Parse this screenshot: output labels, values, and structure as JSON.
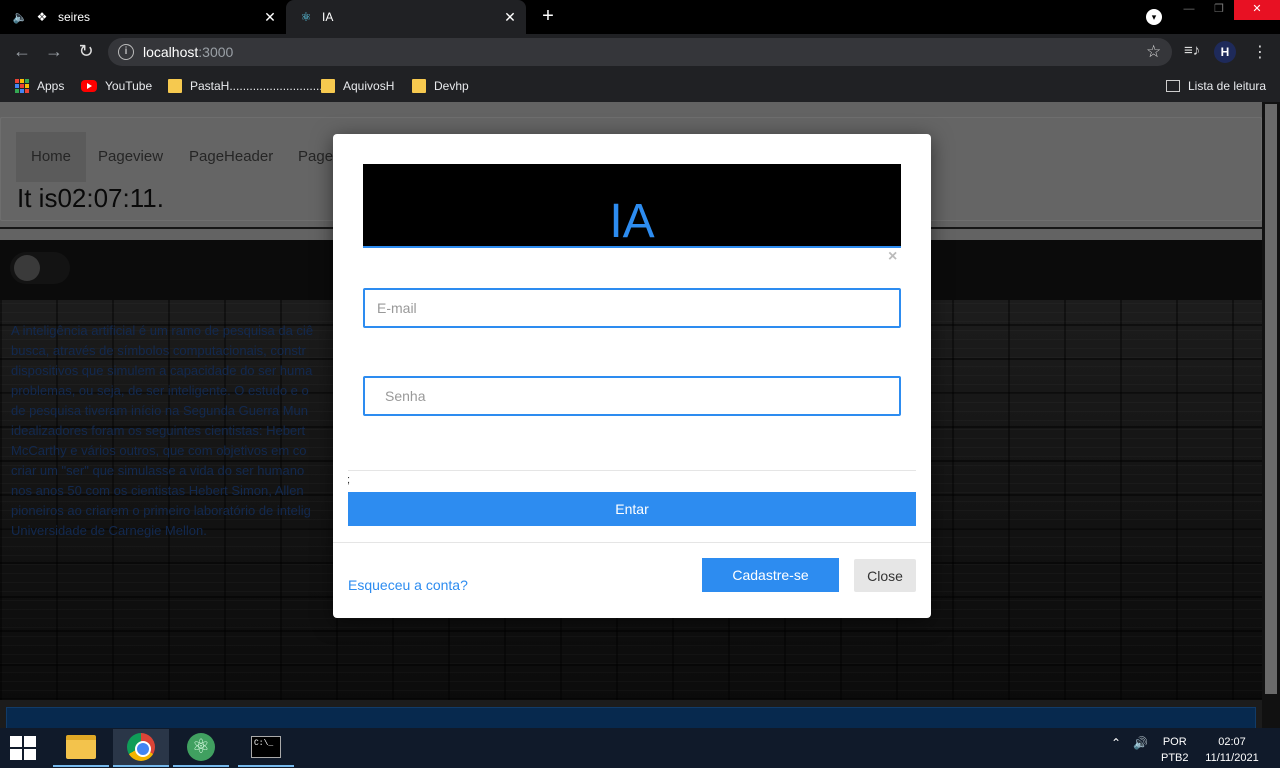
{
  "browser": {
    "tabs": [
      {
        "title": "seires",
        "icon": "audio-icon"
      },
      {
        "title": "IA",
        "icon": "react-icon"
      }
    ],
    "url_host": "localhost",
    "url_port": ":3000",
    "avatar_letter": "H",
    "bookmarks": [
      {
        "label": "Apps",
        "icon": "apps-grid-icon"
      },
      {
        "label": "YouTube",
        "icon": "youtube-icon"
      },
      {
        "label": "PastaH..............................",
        "icon": "folder-icon"
      },
      {
        "label": "AquivosH",
        "icon": "folder-icon"
      },
      {
        "label": "Devhp",
        "icon": "folder-icon"
      }
    ],
    "reading_list": "Lista de leitura"
  },
  "page": {
    "nav": [
      "Home",
      "Pageview",
      "PageHeader",
      "Page"
    ],
    "clock_text": "It is02:07:11.",
    "hero_text": "A inteligência artificial é um ramo de pesquisa da ciê\nbusca, através de símbolos computacionais, constr\ndispositivos que simulem a capacidade do ser huma\nproblemas, ou seja, de ser inteligente. O estudo e o\nde pesquisa tiveram início na Segunda Guerra Mun\nidealizadores foram os seguintes cientistas: Hebert\nMcCarthy e vários outros, que com objetivos em co\ncriar um \"ser\" que simulasse a vida do ser humano\nnos anos 50 com os cientistas Hebert Simon, Allen\npioneiros ao criarem o primeiro laboratório de intelig\nUniversidade de Carnegie Mellon."
  },
  "modal": {
    "banner_title": "IA",
    "close_x": "×",
    "email_placeholder": "E-mail",
    "senha_placeholder": "Senha",
    "separator_char": ";",
    "entrar_label": "Entar",
    "forgot_label": "Esqueceu a conta?",
    "cadastro_label": "Cadastre-se",
    "close_label": "Close",
    "accent_color": "#2d8cf0"
  },
  "taskbar": {
    "lang_line1": "POR",
    "lang_line2": "PTB2",
    "time": "02:07",
    "date": "11/11/2021",
    "apps": [
      "file-explorer-icon",
      "chrome-icon",
      "atom-icon",
      "cmd-icon"
    ]
  }
}
